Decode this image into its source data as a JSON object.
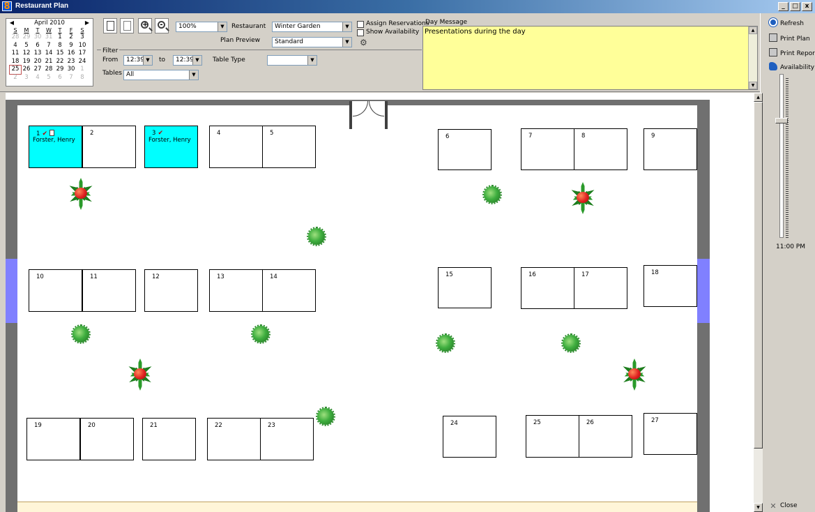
{
  "window": {
    "title": "Restaurant Plan",
    "app_icon": "8",
    "buttons": {
      "minimize": "_",
      "maximize": "□",
      "close": "x"
    }
  },
  "calendar": {
    "month": "April 2010",
    "dow": [
      "S",
      "M",
      "T",
      "W",
      "T",
      "F",
      "S"
    ],
    "weeks": [
      [
        {
          "d": "28",
          "m": 1
        },
        {
          "d": "29",
          "m": 1
        },
        {
          "d": "30",
          "m": 1
        },
        {
          "d": "31",
          "m": 1
        },
        {
          "d": "1"
        },
        {
          "d": "2"
        },
        {
          "d": "3"
        }
      ],
      [
        {
          "d": "4"
        },
        {
          "d": "5"
        },
        {
          "d": "6"
        },
        {
          "d": "7"
        },
        {
          "d": "8"
        },
        {
          "d": "9"
        },
        {
          "d": "10"
        }
      ],
      [
        {
          "d": "11"
        },
        {
          "d": "12"
        },
        {
          "d": "13"
        },
        {
          "d": "14"
        },
        {
          "d": "15"
        },
        {
          "d": "16"
        },
        {
          "d": "17"
        }
      ],
      [
        {
          "d": "18"
        },
        {
          "d": "19"
        },
        {
          "d": "20"
        },
        {
          "d": "21"
        },
        {
          "d": "22"
        },
        {
          "d": "23"
        },
        {
          "d": "24"
        }
      ],
      [
        {
          "d": "25",
          "t": 1
        },
        {
          "d": "26"
        },
        {
          "d": "27"
        },
        {
          "d": "28"
        },
        {
          "d": "29"
        },
        {
          "d": "30"
        },
        {
          "d": "1",
          "m": 1
        }
      ],
      [
        {
          "d": "2",
          "m": 1
        },
        {
          "d": "3",
          "m": 1
        },
        {
          "d": "4",
          "m": 1
        },
        {
          "d": "5",
          "m": 1
        },
        {
          "d": "6",
          "m": 1
        },
        {
          "d": "7",
          "m": 1
        },
        {
          "d": "8",
          "m": 1
        }
      ]
    ]
  },
  "toolbar": {
    "zoom_value": "100%",
    "restaurant_label": "Restaurant",
    "restaurant_value": "Winter Garden",
    "plan_preview_label": "Plan Preview",
    "plan_preview_value": "Standard",
    "assign_reservations_label": "Assign Reservations",
    "show_availability_label": "Show Availability"
  },
  "filter": {
    "group_label": "Filter",
    "from_label": "From",
    "from_value": "12:39",
    "to_label": "to",
    "to_value": "12:39 I",
    "table_type_label": "Table Type",
    "table_type_value": "",
    "tables_label": "Tables",
    "tables_value": "All"
  },
  "day_message": {
    "label": "Day Message",
    "text": "Presentations during the day"
  },
  "sidebar": {
    "refresh": "Refresh",
    "print_plan": "Print Plan",
    "print_report": "Print Report",
    "availability": "Availability",
    "time": "11:00 PM",
    "close": "Close"
  },
  "tables": [
    {
      "num": "1",
      "guest": "Forster, Henry",
      "reserved": true,
      "confirmed": true,
      "note": true
    },
    {
      "num": "2"
    },
    {
      "num": "3",
      "guest": "Forster, Henry",
      "reserved": true,
      "confirmed": true
    },
    {
      "num": "4"
    },
    {
      "num": "5"
    },
    {
      "num": "6"
    },
    {
      "num": "7"
    },
    {
      "num": "8"
    },
    {
      "num": "9"
    },
    {
      "num": "10"
    },
    {
      "num": "11"
    },
    {
      "num": "12"
    },
    {
      "num": "13"
    },
    {
      "num": "14"
    },
    {
      "num": "15"
    },
    {
      "num": "16"
    },
    {
      "num": "17"
    },
    {
      "num": "18"
    },
    {
      "num": "19"
    },
    {
      "num": "20"
    },
    {
      "num": "21"
    },
    {
      "num": "22"
    },
    {
      "num": "23"
    },
    {
      "num": "24"
    },
    {
      "num": "25"
    },
    {
      "num": "26"
    },
    {
      "num": "27"
    }
  ],
  "colors": {
    "reserved_table": "#00ffff",
    "day_message_bg": "#ffff99",
    "window": "#8080ff",
    "wall": "#707070"
  }
}
